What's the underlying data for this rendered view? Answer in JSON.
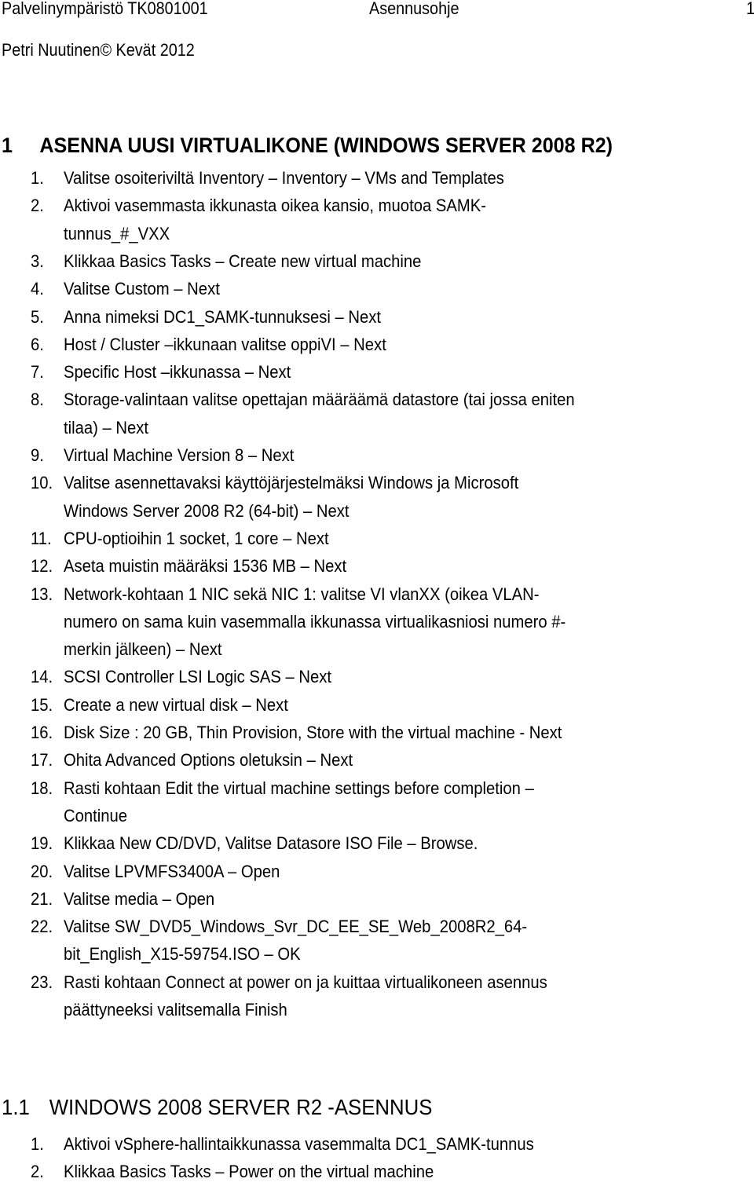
{
  "header": {
    "course": "Palvelinympäristö TK0801001",
    "doc_type": "Asennusohje",
    "page_number": "1"
  },
  "meta": {
    "author_line": "Petri Nuutinen© Kevät 2012"
  },
  "section1": {
    "number": "1",
    "title": "ASENNA UUSI VIRTUALIKONE (WINDOWS SERVER 2008 R2)",
    "steps": [
      {
        "num": "1.",
        "lines": [
          "Valitse osoiteriviltä Inventory – Inventory – VMs and Templates"
        ]
      },
      {
        "num": "2.",
        "lines": [
          "Aktivoi vasemmasta ikkunasta oikea kansio, muotoa SAMK-",
          "tunnus_#_VXX"
        ]
      },
      {
        "num": "3.",
        "lines": [
          "Klikkaa Basics Tasks – Create new virtual machine"
        ]
      },
      {
        "num": "4.",
        "lines": [
          "Valitse Custom – Next"
        ]
      },
      {
        "num": "5.",
        "lines": [
          "Anna nimeksi DC1_SAMK-tunnuksesi – Next"
        ]
      },
      {
        "num": "6.",
        "lines": [
          "Host / Cluster –ikkunaan valitse oppiVI – Next"
        ]
      },
      {
        "num": "7.",
        "lines": [
          "Specific Host –ikkunassa – Next"
        ]
      },
      {
        "num": "8.",
        "lines": [
          "Storage-valintaan valitse opettajan määräämä datastore (tai jossa eniten",
          "tilaa) – Next"
        ]
      },
      {
        "num": "9.",
        "lines": [
          "Virtual Machine Version 8 – Next"
        ]
      },
      {
        "num": "10.",
        "lines": [
          "Valitse asennettavaksi käyttöjärjestelmäksi Windows ja Microsoft",
          "Windows Server 2008 R2 (64-bit) – Next"
        ]
      },
      {
        "num": "11.",
        "lines": [
          "CPU-optioihin 1 socket, 1 core – Next"
        ]
      },
      {
        "num": "12.",
        "lines": [
          "Aseta muistin määräksi 1536 MB – Next"
        ]
      },
      {
        "num": "13.",
        "lines": [
          "Network-kohtaan 1 NIC sekä NIC 1: valitse VI vlanXX (oikea VLAN-",
          "numero on sama kuin vasemmalla ikkunassa virtualikasniosi numero #-",
          "merkin jälkeen) – Next"
        ]
      },
      {
        "num": "14.",
        "lines": [
          "SCSI Controller LSI Logic SAS – Next"
        ]
      },
      {
        "num": "15.",
        "lines": [
          "Create a new virtual disk – Next"
        ]
      },
      {
        "num": "16.",
        "lines": [
          "Disk Size : 20 GB, Thin Provision, Store with the virtual machine  - Next"
        ]
      },
      {
        "num": "17.",
        "lines": [
          "Ohita Advanced Options oletuksin – Next"
        ]
      },
      {
        "num": "18.",
        "lines": [
          "Rasti kohtaan Edit the virtual machine settings before completion –",
          "Continue"
        ]
      },
      {
        "num": "19.",
        "lines": [
          "Klikkaa New CD/DVD, Valitse Datasore ISO File – Browse."
        ]
      },
      {
        "num": "20.",
        "lines": [
          "Valitse LPVMFS3400A – Open"
        ]
      },
      {
        "num": "21.",
        "lines": [
          "Valitse media – Open"
        ]
      },
      {
        "num": "22.",
        "lines": [
          "Valitse SW_DVD5_Windows_Svr_DC_EE_SE_Web_2008R2_64-",
          "bit_English_X15-59754.ISO – OK"
        ]
      },
      {
        "num": "23.",
        "lines": [
          "Rasti kohtaan Connect at power on ja kuittaa virtualikoneen asennus",
          "päättyneeksi valitsemalla Finish"
        ]
      }
    ]
  },
  "section1_1": {
    "number": "1.1",
    "title": "WINDOWS 2008 SERVER R2 -ASENNUS",
    "steps": [
      {
        "num": "1.",
        "lines": [
          "Aktivoi vSphere-hallintaikkunassa vasemmalta DC1_SAMK-tunnus"
        ]
      },
      {
        "num": "2.",
        "lines": [
          "Klikkaa Basics Tasks – Power on the virtual machine"
        ]
      }
    ]
  }
}
